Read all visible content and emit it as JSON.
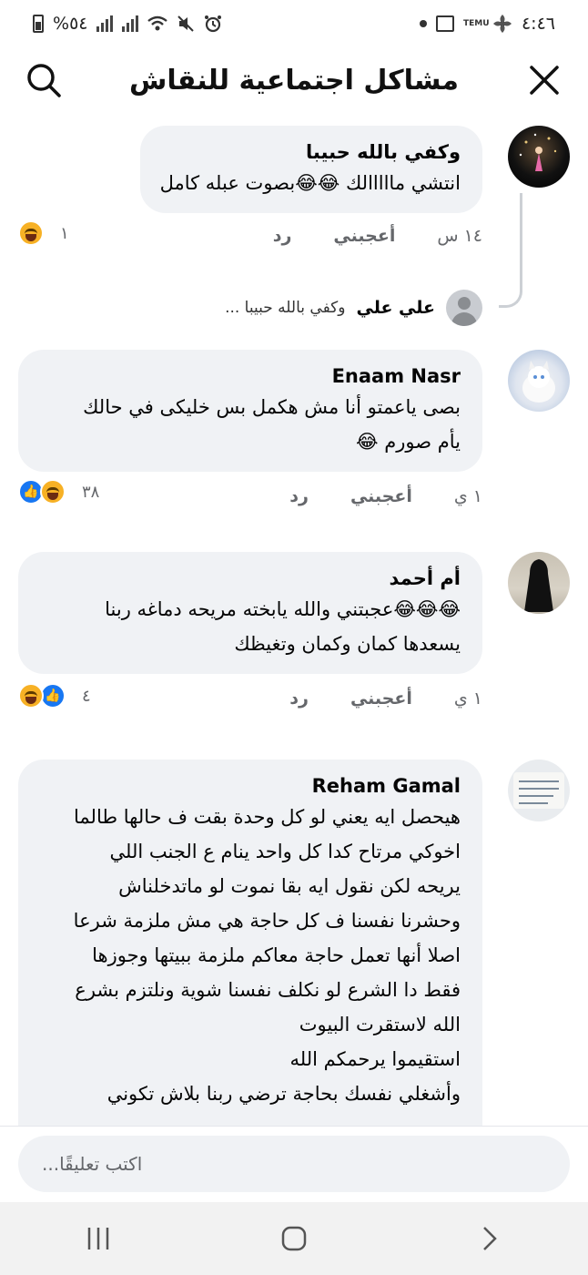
{
  "status_bar": {
    "time": "٤:٤٦",
    "battery_text": "%٥٤",
    "temu_label": "TEMU"
  },
  "header": {
    "title": "مشاكل اجتماعية للنقاش"
  },
  "comments": [
    {
      "author": "وكفي بالله حبيبا",
      "lines": [
        "انتشي مااااالك 😂😂بصوت عبله كامل"
      ],
      "time": "١٤ س",
      "like_label": "أعجبني",
      "reply_label": "رد",
      "reaction_count": "١",
      "reactions": [
        "haha"
      ],
      "reply_preview": {
        "name": "علي علي",
        "snippet": "وكفي بالله حبيبا ..."
      }
    },
    {
      "author": "Enaam Nasr",
      "lines": [
        "بصى ياعمتو أنا مش هكمل بس خليكى في حالك",
        "يأم صورم 😂"
      ],
      "time": "١ ي",
      "like_label": "أعجبني",
      "reply_label": "رد",
      "reaction_count": "٣٨",
      "reactions": [
        "haha",
        "like"
      ]
    },
    {
      "author": "أم أحمد",
      "lines": [
        "😂😂😂عجبتني والله يابخته مريحه دماغه ربنا",
        "يسعدها كمان وكمان وتغيظك"
      ],
      "time": "١ ي",
      "like_label": "أعجبني",
      "reply_label": "رد",
      "reaction_count": "٤",
      "reactions": [
        "like",
        "haha"
      ]
    },
    {
      "author": "Reham Gamal",
      "lines": [
        "هيحصل ايه يعني لو كل وحدة بقت ف حالها طالما",
        "اخوكي مرتاح كدا كل واحد ينام ع الجنب اللي",
        "يريحه لكن نقول ايه بقا نموت لو ماتدخلناش",
        "وحشرنا نفسنا ف كل حاجة هي مش ملزمة شرعا",
        "اصلا أنها تعمل حاجة معاكم ملزمة ببيتها وجوزها",
        "فقط دا الشرع لو نكلف نفسنا شوية ونلتزم بشرع",
        "الله لاستقرت البيوت",
        "استقيموا يرحمكم الله",
        "وأشغلي نفسك بحاجة ترضي ربنا بلاش تكوني"
      ]
    }
  ],
  "compose": {
    "placeholder": "اكتب تعليقًا..."
  }
}
